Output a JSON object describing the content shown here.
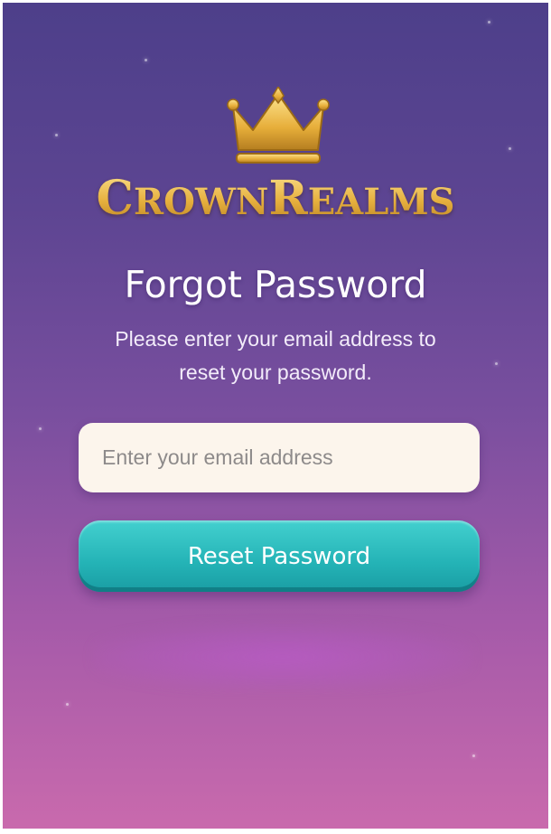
{
  "app": {
    "logo_name": "CrownRealms",
    "logo_part1_cap": "C",
    "logo_part1_rest": "ROWN",
    "logo_part2_cap": "R",
    "logo_part2_rest": "EALMS"
  },
  "page": {
    "title": "Forgot Password",
    "subtitle": "Please enter your email address to reset your password."
  },
  "form": {
    "email_placeholder": "Enter your email address",
    "email_value": "",
    "submit_label": "Reset Password"
  },
  "icons": {
    "logo_icon": "crown-icon"
  },
  "colors": {
    "gradient_top": "#4d3f8a",
    "gradient_bottom": "#c96aad",
    "logo_gold": "#e8b847",
    "input_bg": "#fcf5ec",
    "button_teal": "#24b3b6"
  }
}
